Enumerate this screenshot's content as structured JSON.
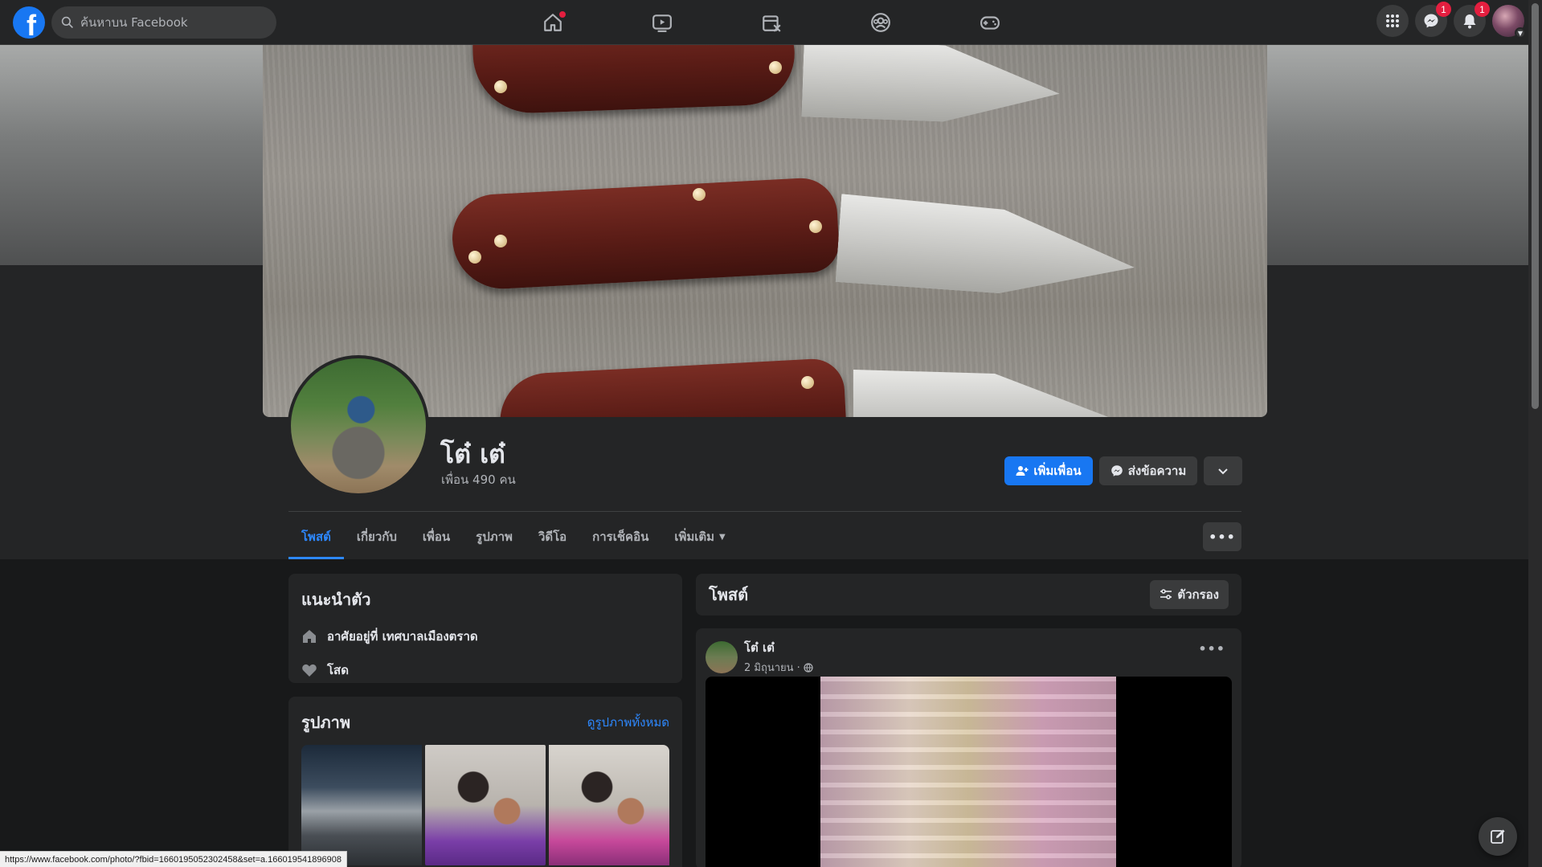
{
  "topbar": {
    "logo": "f",
    "search_placeholder": "ค้นหาบน Facebook",
    "nav_icons": [
      "home-icon",
      "watch-icon",
      "marketplace-icon",
      "groups-icon",
      "gaming-icon"
    ],
    "messenger_badge": "1",
    "notifications_badge": "1"
  },
  "profile": {
    "name": "โต๋ เต๋",
    "friends": "เพื่อน 490 คน",
    "add_friend": "เพิ่มเพื่อน",
    "message": "ส่งข้อความ"
  },
  "tabs": [
    {
      "label": "โพสต์"
    },
    {
      "label": "เกี่ยวกับ"
    },
    {
      "label": "เพื่อน"
    },
    {
      "label": "รูปภาพ"
    },
    {
      "label": "วิดีโอ"
    },
    {
      "label": "การเช็คอิน"
    },
    {
      "label": "เพิ่มเติม"
    }
  ],
  "intro": {
    "title": "แนะนำตัว",
    "lives_in": "อาศัยอยู่ที่ เทศบาลเมืองตราด",
    "relationship": "โสด"
  },
  "photos": {
    "title": "รูปภาพ",
    "see_all": "ดูรูปภาพทั้งหมด"
  },
  "posts": {
    "title": "โพสต์",
    "filter": "ตัวกรอง",
    "post": {
      "author": "โต๋ เต๋",
      "date": "2 มิถุนายน ·"
    }
  },
  "status_url": "https://www.facebook.com/photo/?fbid=1660195052302458&set=a.166019541896908",
  "colors": {
    "accent": "#1877f2",
    "link": "#2d88ff",
    "badge": "#e41e3f",
    "surface": "#242526",
    "background": "#18191a"
  }
}
